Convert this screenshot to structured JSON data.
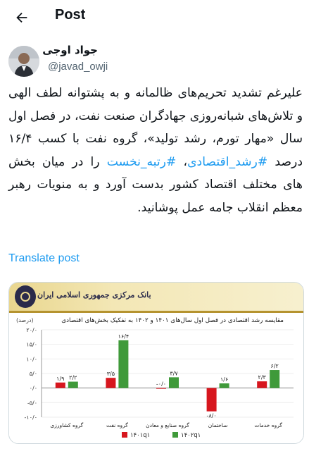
{
  "header": {
    "title": "Post"
  },
  "author": {
    "name": "جواد اوجی",
    "handle": "@javad_owji"
  },
  "tweet": {
    "segments": [
      {
        "text": "علیرغم تشدید تحریم‌های ظالمانه و به پشتوانه لطف الهی و تلاش‌های شبانه‌روزی جهادگران صنعت نفت، در فصل اول سال «مهار تورم، رشد تولید»، گروه نفت با کسب ۱۶/۴ درصد ",
        "hash": false
      },
      {
        "text": "#رشد_اقتصادی",
        "hash": true
      },
      {
        "text": "، ",
        "hash": false
      },
      {
        "text": "#رتبه_نخست",
        "hash": true
      },
      {
        "text": " را در میان بخش های مختلف اقتصاد کشور بدست آورد و به منویات رهبر معظم انقلاب جامه عمل پوشانید.",
        "hash": false
      }
    ]
  },
  "translate_label": "Translate post",
  "media": {
    "bank_name": "بانک مرکزی جمهوری اسلامی ایران",
    "unit": "(درصد)",
    "colors": {
      "s1401": "#d7161e",
      "s1402": "#3f9a3a",
      "banner": "#e9d68e"
    },
    "chart_data": {
      "type": "bar",
      "title": "مقایسه رشد اقتصادی در فصل اول سال‌های ۱۴۰۱ و ۱۴۰۲ به تفکیک بخش‌های اقتصادی",
      "categories": [
        "گروه کشاورزی",
        "گروه نفت",
        "گروه صنایع و معادن",
        "ساختمان",
        "گروه خدمات"
      ],
      "series": [
        {
          "name": "۱۴۰۱q۱",
          "values": [
            1.9,
            3.5,
            -0.0,
            -8.0,
            2.3
          ],
          "labels": [
            "۱/۹",
            "۳/۵",
            "-۰/۰",
            "-۸/۰",
            "۲/۳"
          ]
        },
        {
          "name": "۱۴۰۲q۱",
          "values": [
            2.2,
            16.4,
            3.7,
            1.6,
            6.2
          ],
          "labels": [
            "۲/۲",
            "۱۶/۴",
            "۳/۷",
            "۱/۶",
            "۶/۲"
          ]
        }
      ],
      "yticks": [
        20,
        15,
        10,
        5,
        0,
        -5,
        -10
      ],
      "ytick_labels": [
        "۲۰/۰",
        "۱۵/۰",
        "۱۰/۰",
        "۵/۰",
        "۰/۰",
        "-۵/۰",
        "-۱۰/۰"
      ],
      "ylim": [
        -10,
        20
      ]
    }
  }
}
